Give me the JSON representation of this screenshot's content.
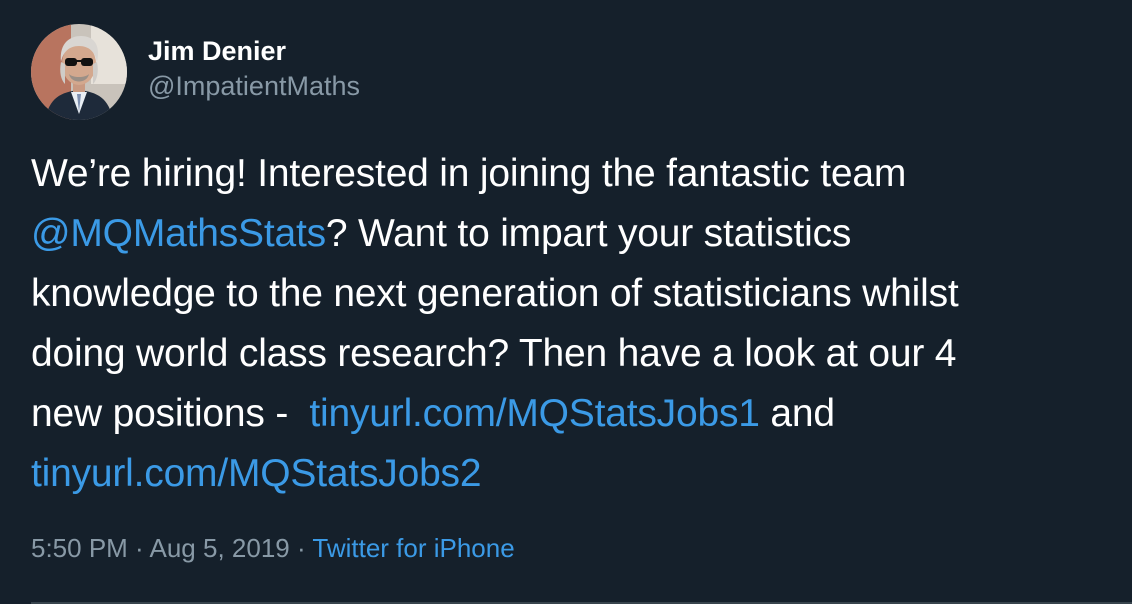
{
  "author": {
    "display_name": "Jim Denier",
    "handle": "@ImpatientMaths"
  },
  "tweet": {
    "line1": "We’re hiring! Interested in joining the fantastic team",
    "mention": "@MQMathsStats",
    "line2_rest": "? Want to impart your statistics",
    "line3": "knowledge to the next generation of statisticians whilst",
    "line4": "doing world class research? Then have a look at our 4",
    "line5_prefix": "new positions -  ",
    "link1": "tinyurl.com/MQStatsJobs1",
    "line5_suffix": " and",
    "link2": "tinyurl.com/MQStatsJobs2"
  },
  "meta": {
    "time": "5:50 PM",
    "separator1": " · ",
    "date": "Aug 5, 2019",
    "separator2": " · ",
    "source": "Twitter for iPhone"
  },
  "colors": {
    "background": "#15202b",
    "link": "#3b9ae6",
    "secondary_text": "#8899a6",
    "divider": "#38444d"
  }
}
